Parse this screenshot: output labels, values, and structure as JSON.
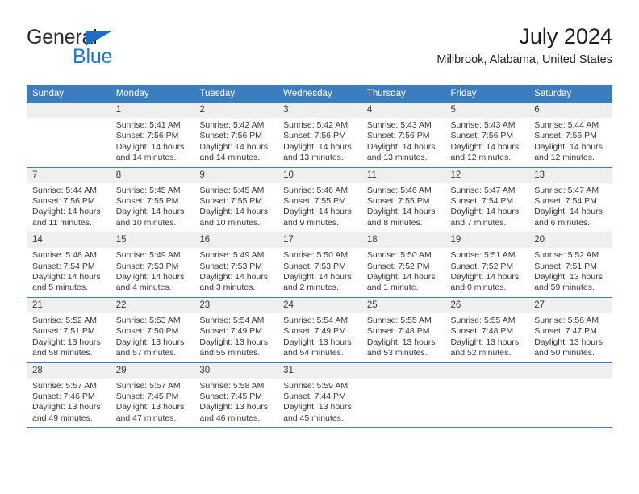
{
  "logo": {
    "word1": "General",
    "word2": "Blue",
    "triangle_color": "#1A6FC4",
    "word2_color": "#1A79D0"
  },
  "header": {
    "title": "July 2024",
    "subtitle": "Millbrook, Alabama, United States"
  },
  "theme": {
    "header_blue": "#3B7DBF",
    "daynum_band": "#EFEFEF",
    "text": "#3a3a3a"
  },
  "weekdays": [
    "Sunday",
    "Monday",
    "Tuesday",
    "Wednesday",
    "Thursday",
    "Friday",
    "Saturday"
  ],
  "weeks": [
    [
      {
        "day": "",
        "sunrise": "",
        "sunset": "",
        "daylight": "",
        "empty": true
      },
      {
        "day": "1",
        "sunrise": "Sunrise: 5:41 AM",
        "sunset": "Sunset: 7:56 PM",
        "daylight": "Daylight: 14 hours and 14 minutes."
      },
      {
        "day": "2",
        "sunrise": "Sunrise: 5:42 AM",
        "sunset": "Sunset: 7:56 PM",
        "daylight": "Daylight: 14 hours and 14 minutes."
      },
      {
        "day": "3",
        "sunrise": "Sunrise: 5:42 AM",
        "sunset": "Sunset: 7:56 PM",
        "daylight": "Daylight: 14 hours and 13 minutes."
      },
      {
        "day": "4",
        "sunrise": "Sunrise: 5:43 AM",
        "sunset": "Sunset: 7:56 PM",
        "daylight": "Daylight: 14 hours and 13 minutes."
      },
      {
        "day": "5",
        "sunrise": "Sunrise: 5:43 AM",
        "sunset": "Sunset: 7:56 PM",
        "daylight": "Daylight: 14 hours and 12 minutes."
      },
      {
        "day": "6",
        "sunrise": "Sunrise: 5:44 AM",
        "sunset": "Sunset: 7:56 PM",
        "daylight": "Daylight: 14 hours and 12 minutes."
      }
    ],
    [
      {
        "day": "7",
        "sunrise": "Sunrise: 5:44 AM",
        "sunset": "Sunset: 7:56 PM",
        "daylight": "Daylight: 14 hours and 11 minutes."
      },
      {
        "day": "8",
        "sunrise": "Sunrise: 5:45 AM",
        "sunset": "Sunset: 7:55 PM",
        "daylight": "Daylight: 14 hours and 10 minutes."
      },
      {
        "day": "9",
        "sunrise": "Sunrise: 5:45 AM",
        "sunset": "Sunset: 7:55 PM",
        "daylight": "Daylight: 14 hours and 10 minutes."
      },
      {
        "day": "10",
        "sunrise": "Sunrise: 5:46 AM",
        "sunset": "Sunset: 7:55 PM",
        "daylight": "Daylight: 14 hours and 9 minutes."
      },
      {
        "day": "11",
        "sunrise": "Sunrise: 5:46 AM",
        "sunset": "Sunset: 7:55 PM",
        "daylight": "Daylight: 14 hours and 8 minutes."
      },
      {
        "day": "12",
        "sunrise": "Sunrise: 5:47 AM",
        "sunset": "Sunset: 7:54 PM",
        "daylight": "Daylight: 14 hours and 7 minutes."
      },
      {
        "day": "13",
        "sunrise": "Sunrise: 5:47 AM",
        "sunset": "Sunset: 7:54 PM",
        "daylight": "Daylight: 14 hours and 6 minutes."
      }
    ],
    [
      {
        "day": "14",
        "sunrise": "Sunrise: 5:48 AM",
        "sunset": "Sunset: 7:54 PM",
        "daylight": "Daylight: 14 hours and 5 minutes."
      },
      {
        "day": "15",
        "sunrise": "Sunrise: 5:49 AM",
        "sunset": "Sunset: 7:53 PM",
        "daylight": "Daylight: 14 hours and 4 minutes."
      },
      {
        "day": "16",
        "sunrise": "Sunrise: 5:49 AM",
        "sunset": "Sunset: 7:53 PM",
        "daylight": "Daylight: 14 hours and 3 minutes."
      },
      {
        "day": "17",
        "sunrise": "Sunrise: 5:50 AM",
        "sunset": "Sunset: 7:53 PM",
        "daylight": "Daylight: 14 hours and 2 minutes."
      },
      {
        "day": "18",
        "sunrise": "Sunrise: 5:50 AM",
        "sunset": "Sunset: 7:52 PM",
        "daylight": "Daylight: 14 hours and 1 minute."
      },
      {
        "day": "19",
        "sunrise": "Sunrise: 5:51 AM",
        "sunset": "Sunset: 7:52 PM",
        "daylight": "Daylight: 14 hours and 0 minutes."
      },
      {
        "day": "20",
        "sunrise": "Sunrise: 5:52 AM",
        "sunset": "Sunset: 7:51 PM",
        "daylight": "Daylight: 13 hours and 59 minutes."
      }
    ],
    [
      {
        "day": "21",
        "sunrise": "Sunrise: 5:52 AM",
        "sunset": "Sunset: 7:51 PM",
        "daylight": "Daylight: 13 hours and 58 minutes."
      },
      {
        "day": "22",
        "sunrise": "Sunrise: 5:53 AM",
        "sunset": "Sunset: 7:50 PM",
        "daylight": "Daylight: 13 hours and 57 minutes."
      },
      {
        "day": "23",
        "sunrise": "Sunrise: 5:54 AM",
        "sunset": "Sunset: 7:49 PM",
        "daylight": "Daylight: 13 hours and 55 minutes."
      },
      {
        "day": "24",
        "sunrise": "Sunrise: 5:54 AM",
        "sunset": "Sunset: 7:49 PM",
        "daylight": "Daylight: 13 hours and 54 minutes."
      },
      {
        "day": "25",
        "sunrise": "Sunrise: 5:55 AM",
        "sunset": "Sunset: 7:48 PM",
        "daylight": "Daylight: 13 hours and 53 minutes."
      },
      {
        "day": "26",
        "sunrise": "Sunrise: 5:55 AM",
        "sunset": "Sunset: 7:48 PM",
        "daylight": "Daylight: 13 hours and 52 minutes."
      },
      {
        "day": "27",
        "sunrise": "Sunrise: 5:56 AM",
        "sunset": "Sunset: 7:47 PM",
        "daylight": "Daylight: 13 hours and 50 minutes."
      }
    ],
    [
      {
        "day": "28",
        "sunrise": "Sunrise: 5:57 AM",
        "sunset": "Sunset: 7:46 PM",
        "daylight": "Daylight: 13 hours and 49 minutes."
      },
      {
        "day": "29",
        "sunrise": "Sunrise: 5:57 AM",
        "sunset": "Sunset: 7:45 PM",
        "daylight": "Daylight: 13 hours and 47 minutes."
      },
      {
        "day": "30",
        "sunrise": "Sunrise: 5:58 AM",
        "sunset": "Sunset: 7:45 PM",
        "daylight": "Daylight: 13 hours and 46 minutes."
      },
      {
        "day": "31",
        "sunrise": "Sunrise: 5:59 AM",
        "sunset": "Sunset: 7:44 PM",
        "daylight": "Daylight: 13 hours and 45 minutes."
      },
      {
        "day": "",
        "sunrise": "",
        "sunset": "",
        "daylight": "",
        "empty": true
      },
      {
        "day": "",
        "sunrise": "",
        "sunset": "",
        "daylight": "",
        "empty": true
      },
      {
        "day": "",
        "sunrise": "",
        "sunset": "",
        "daylight": "",
        "empty": true
      }
    ]
  ]
}
